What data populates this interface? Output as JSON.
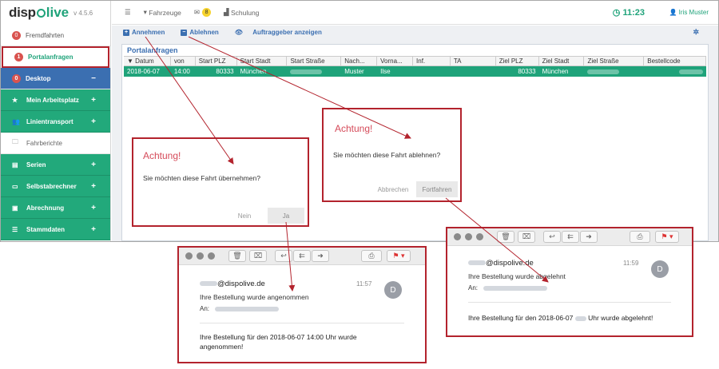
{
  "app": {
    "logo_a": "disp",
    "logo_b": "live",
    "version": "v 4.5.6"
  },
  "sidebar": {
    "items": [
      {
        "label": "Fremdfahrten",
        "badge": "0"
      },
      {
        "label": "Portalanfragen",
        "badge": "1"
      },
      {
        "label": "Desktop",
        "badge": "0",
        "toggle": "−"
      },
      {
        "label": "Mein Arbeitsplatz",
        "toggle": "+"
      },
      {
        "label": "Linientransport",
        "toggle": "+"
      },
      {
        "label": "Fahrberichte"
      },
      {
        "label": "Serien",
        "toggle": "+"
      },
      {
        "label": "Selbstabrechner",
        "toggle": "+"
      },
      {
        "label": "Abrechnung",
        "toggle": "+"
      },
      {
        "label": "Stammdaten",
        "toggle": "+"
      }
    ]
  },
  "topbar": {
    "vehicles": "Fahrzeuge",
    "messages_count": "8",
    "training": "Schulung",
    "clock": "11:23",
    "user": "Iris Muster"
  },
  "toolbar": {
    "accept": "Annehmen",
    "reject": "Ablehnen",
    "show_client": "Auftraggeber anzeigen"
  },
  "panel": {
    "title": "Portalanfragen"
  },
  "table": {
    "columns": [
      "▼ Datum",
      "von",
      "Start PLZ",
      "Start Stadt",
      "Start Straße",
      "Nach...",
      "Vorna...",
      "Inf.",
      "TA",
      "Ziel PLZ",
      "Ziel Stadt",
      "Ziel Straße",
      "Bestellcode"
    ],
    "row": {
      "datum": "2018-06-07",
      "von": "14:00",
      "start_plz": "80333",
      "start_stadt": "München",
      "nachname": "Muster",
      "vorname": "Ilse",
      "ziel_plz": "80333",
      "ziel_stadt": "München"
    }
  },
  "dialog_accept": {
    "title": "Achtung!",
    "message": "Sie möchten diese Fahrt übernehmen?",
    "no": "Nein",
    "yes": "Ja"
  },
  "dialog_reject": {
    "title": "Achtung!",
    "message": "Sie möchten diese Fahrt ablehnen?",
    "cancel": "Abbrechen",
    "confirm": "Fortfahren"
  },
  "mail_accept": {
    "from": "@dispolive.de",
    "time": "11:57",
    "subject": "Ihre Bestellung wurde angenommen",
    "to_label": "An:",
    "avatar": "D",
    "body": "Ihre Bestellung für den 2018-06-07 14:00 Uhr wurde angenommen!"
  },
  "mail_reject": {
    "from": "@dispolive.de",
    "time": "11:59",
    "subject": "Ihre Bestellung wurde abgelehnt",
    "to_label": "An:",
    "avatar": "D",
    "body_a": "Ihre Bestellung für den 2018-06-07",
    "body_b": "Uhr wurde abgelehnt!"
  },
  "colors": {
    "green": "#22a97b",
    "blue": "#3b6fb1",
    "red_frame": "#b3232d",
    "alert": "#d54a59"
  }
}
